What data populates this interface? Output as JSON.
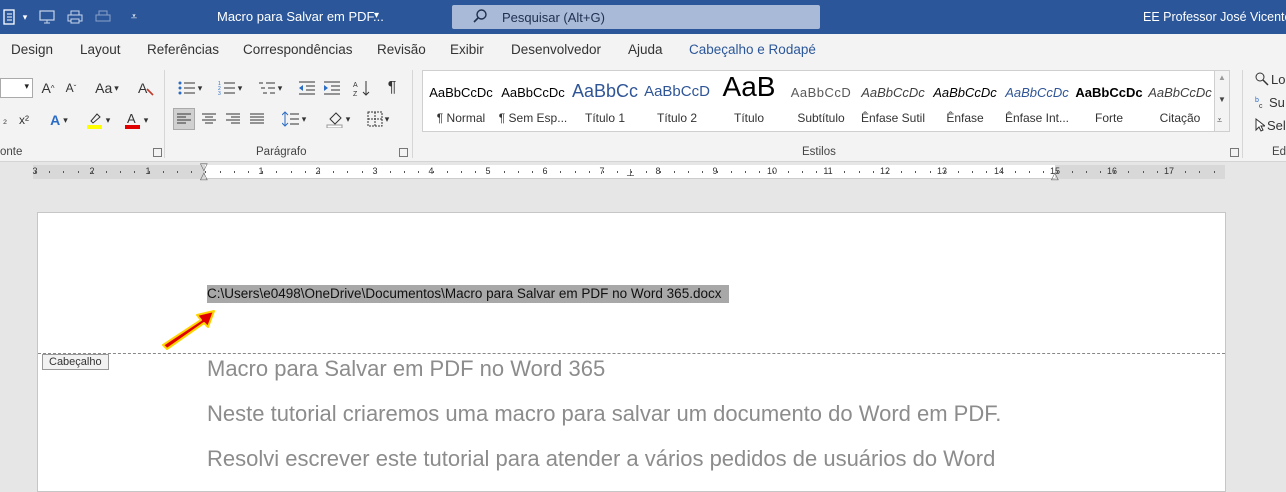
{
  "titlebar": {
    "doc_title": "Macro para Salvar em PDF...",
    "search_placeholder": "Pesquisar (Alt+G)",
    "user_name": "EE Professor José Vicente Be"
  },
  "menu": {
    "tabs": [
      "Design",
      "Layout",
      "Referências",
      "Correspondências",
      "Revisão",
      "Exibir",
      "Desenvolvedor",
      "Ajuda",
      "Cabeçalho e Rodapé"
    ],
    "active_tab": "Cabeçalho e Rodapé"
  },
  "ribbon": {
    "groups": {
      "font": "onte",
      "paragraph": "Parágrafo",
      "styles": "Estilos",
      "edit": "Ed"
    },
    "font_case_label": "Aa",
    "styles": [
      {
        "preview": "AaBbCcDc",
        "name": "¶ Normal",
        "color": "#000000"
      },
      {
        "preview": "AaBbCcDc",
        "name": "¶ Sem Esp...",
        "color": "#000000"
      },
      {
        "preview": "AaBbCc",
        "name": "Título 1",
        "color": "#2f5597"
      },
      {
        "preview": "AaBbCcD",
        "name": "Título 2",
        "color": "#2f5597"
      },
      {
        "preview": "AaB",
        "name": "Título",
        "color": "#000000"
      },
      {
        "preview": "AaBbCcD",
        "name": "Subtítulo",
        "color": "#595959"
      },
      {
        "preview": "AaBbCcDc",
        "name": "Ênfase Sutil",
        "color": "#404040"
      },
      {
        "preview": "AaBbCcDc",
        "name": "Ênfase",
        "color": "#000000"
      },
      {
        "preview": "AaBbCcDc",
        "name": "Ênfase Int...",
        "color": "#2f5597"
      },
      {
        "preview": "AaBbCcDc",
        "name": "Forte",
        "color": "#000000"
      },
      {
        "preview": "AaBbCcDc",
        "name": "Citação",
        "color": "#404040"
      }
    ],
    "edit_items": [
      "Lo",
      "Su",
      "Sel"
    ]
  },
  "ruler": {
    "numbers": [
      "3",
      "2",
      "1",
      "1",
      "2",
      "3",
      "4",
      "5",
      "6",
      "7",
      "8",
      "9",
      "10",
      "11",
      "12",
      "13",
      "14",
      "15",
      "16",
      "17"
    ]
  },
  "document": {
    "header_path": "C:\\Users\\e0498\\OneDrive\\Documentos\\Macro para Salvar em PDF no Word 365.docx",
    "header_tag": "Cabeçalho",
    "body_lines": [
      "Macro para Salvar em PDF no Word 365",
      "Neste tutorial criaremos uma macro para salvar um documento do Word em PDF.",
      "Resolvi escrever este tutorial para atender a vários pedidos de usuários do Word"
    ]
  },
  "colors": {
    "titlebar": "#2b579a",
    "accent_arrow": "#e00000",
    "arrow_outline": "#ffd400"
  }
}
